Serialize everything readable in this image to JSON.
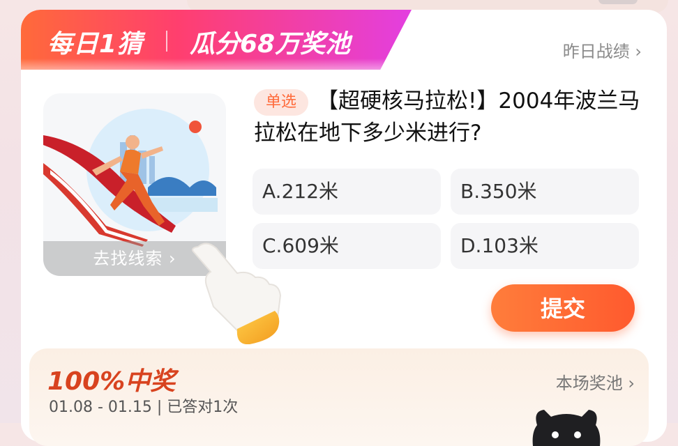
{
  "banner": {
    "title": "每日1猜",
    "subtitle": "瓜分68万奖池",
    "history_link": "昨日战绩 ›"
  },
  "clue": {
    "label": "去找线索 ›"
  },
  "question": {
    "tag": "单选",
    "text": "【超硬核马拉松!】2004年波兰马拉松在地下多少米进行?"
  },
  "options": [
    {
      "label": "A.212米"
    },
    {
      "label": "B.350米"
    },
    {
      "label": "C.609米"
    },
    {
      "label": "D.103米"
    }
  ],
  "submit_label": "提交",
  "prize": {
    "title": "100%中奖",
    "subtitle": "01.08 - 01.15 | 已答对1次",
    "pool_link": "本场奖池 ›"
  },
  "colors": {
    "accent": "#ff6a3a",
    "banner_gradient_end": "#e33fe0",
    "prize_title": "#d8431f"
  },
  "icons": [
    "runner-illustration",
    "pointing-hand-icon",
    "chevron-right-icon",
    "mascot-icon"
  ]
}
